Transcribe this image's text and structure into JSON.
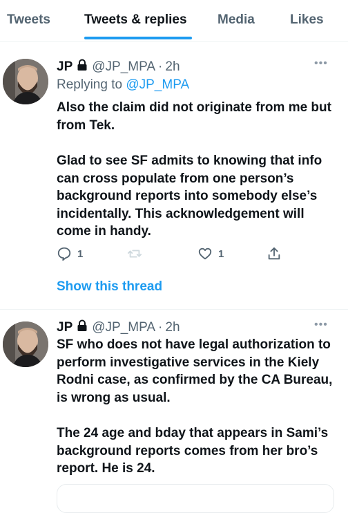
{
  "tabs": [
    {
      "label": "Tweets"
    },
    {
      "label": "Tweets & replies"
    },
    {
      "label": "Media"
    },
    {
      "label": "Likes"
    }
  ],
  "accent_color": "#1d9bf0",
  "tweets": [
    {
      "name": "JP",
      "handle": "@JP_MPA",
      "separator": "·",
      "time": "2h",
      "replying_label": "Replying to ",
      "replying_to": "@JP_MPA",
      "paragraphs": [
        "Also the claim did not originate from me but from Tek.",
        "Glad to see SF admits to knowing that info can cross populate from one person’s background reports into somebody else’s incidentally. This acknowledgement will come in handy."
      ],
      "reply_count": "1",
      "retweet_count": "",
      "like_count": "1",
      "show_thread": "Show this thread"
    },
    {
      "name": "JP",
      "handle": "@JP_MPA",
      "separator": "·",
      "time": "2h",
      "paragraphs": [
        "SF who does not have legal authorization to perform investigative services in the Kiely Rodni case, as confirmed by the CA Bureau, is wrong as usual.",
        "The 24 age and bday that appears in Sami’s background reports comes from her bro’s report. He is 24."
      ]
    }
  ],
  "icons": {
    "lock": "lock-icon",
    "more": "more-icon",
    "reply": "reply-icon",
    "retweet": "retweet-icon",
    "like": "heart-icon",
    "share": "share-icon"
  }
}
